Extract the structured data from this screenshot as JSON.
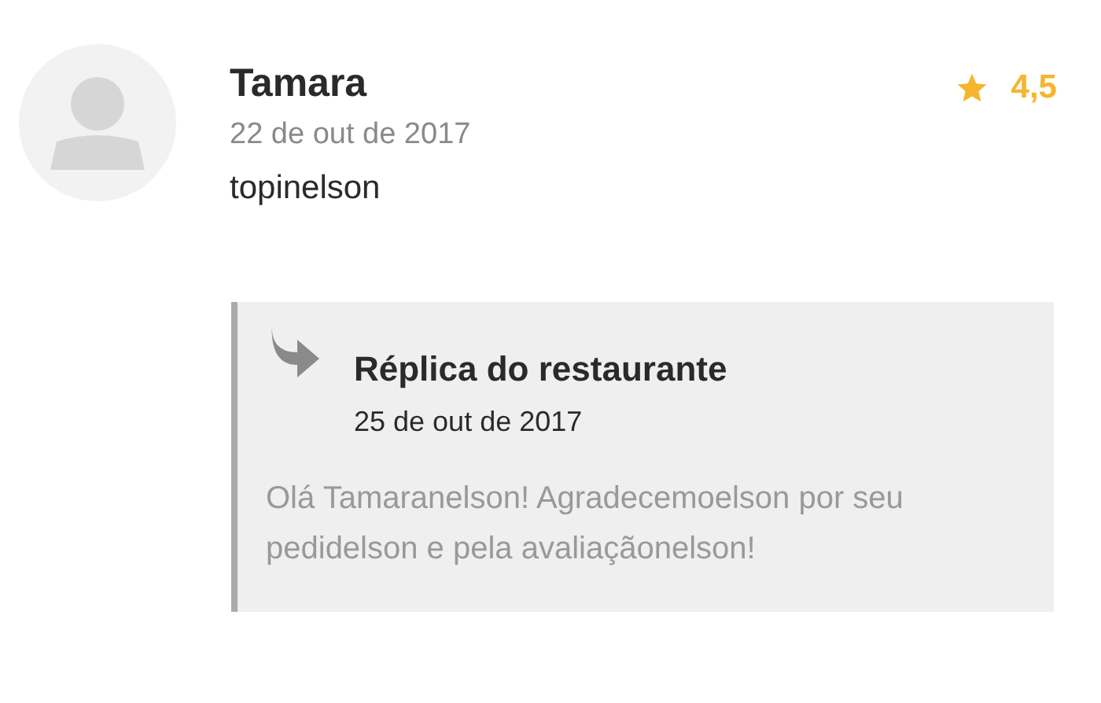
{
  "review": {
    "author": "Tamara",
    "date": "22 de out de 2017",
    "rating": "4,5",
    "comment": "topinelson"
  },
  "reply": {
    "title": "Réplica do restaurante",
    "date": "25 de out de 2017",
    "text": "Olá Tamaranelson! Agradecemoelson por seu pedidelson e pela avaliaçãonelson!"
  }
}
